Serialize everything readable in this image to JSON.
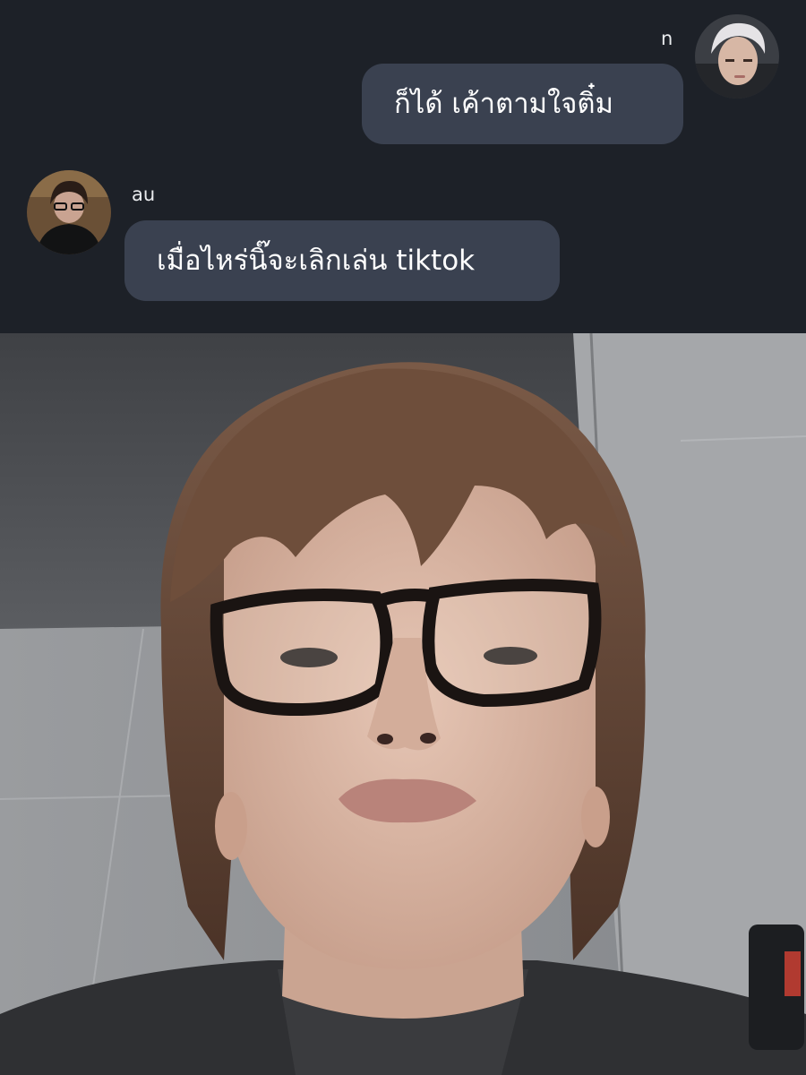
{
  "chat": {
    "messages": [
      {
        "sender": "n",
        "side": "right",
        "text": "ก็ได้ เค้าตามใจติ๋ม",
        "avatar_icon": "user-avatar-icon"
      },
      {
        "sender": "au",
        "side": "left",
        "text": "เมื่อไหร่นิ๊จะเลิกเล่น tiktok",
        "avatar_icon": "user-avatar-icon"
      }
    ],
    "colors": {
      "background": "#1d2128",
      "bubble": "#3a4150",
      "text": "#ffffff"
    }
  },
  "photo": {
    "kind": "selfie",
    "colors": {
      "wall": "#8f9194",
      "ceiling": "#505256",
      "hair": "#6b4a37",
      "skin": "#d9b6a4",
      "glasses": "#1a1412",
      "shirt": "#2f3033"
    }
  }
}
